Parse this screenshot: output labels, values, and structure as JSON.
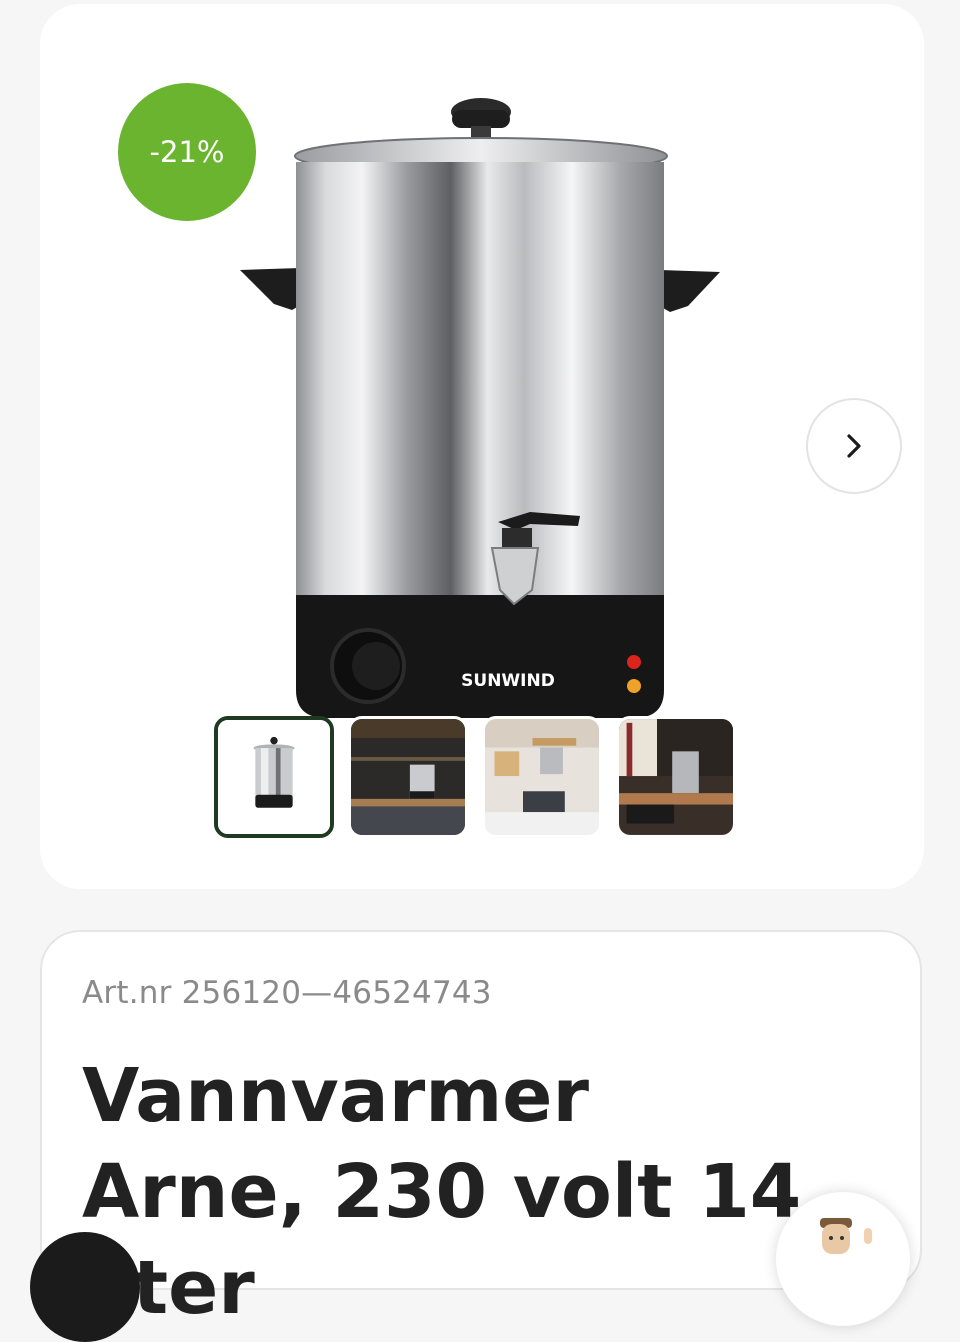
{
  "gallery": {
    "discount_badge": "-21%",
    "brand_logo_text": "SUNWIND",
    "next_icon": "chevron-right-icon",
    "thumbnails": [
      {
        "name": "thumbnail-product",
        "active": true
      },
      {
        "name": "thumbnail-kitchen-dark",
        "active": false
      },
      {
        "name": "thumbnail-cabin-kitchen",
        "active": false
      },
      {
        "name": "thumbnail-kitchen-counter",
        "active": false
      }
    ]
  },
  "product": {
    "art_nr": "Art.nr 256120—46524743",
    "title": "Vannvarmer Arne, 230 volt 14 liter"
  },
  "colors": {
    "badge_bg": "#6ab42f",
    "active_thumb_border": "#1f3a23"
  }
}
